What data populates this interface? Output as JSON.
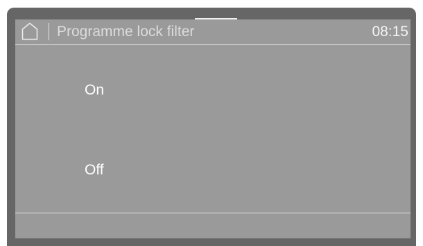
{
  "header": {
    "home_icon": "home-icon",
    "title": "Programme lock filter",
    "time": "08:15"
  },
  "options": [
    {
      "label": "On"
    },
    {
      "label": "Off"
    }
  ],
  "colors": {
    "bezel": "#666666",
    "screen": "#9a9a9b",
    "text": "#ffffff",
    "divider": "#e6e6e6"
  }
}
